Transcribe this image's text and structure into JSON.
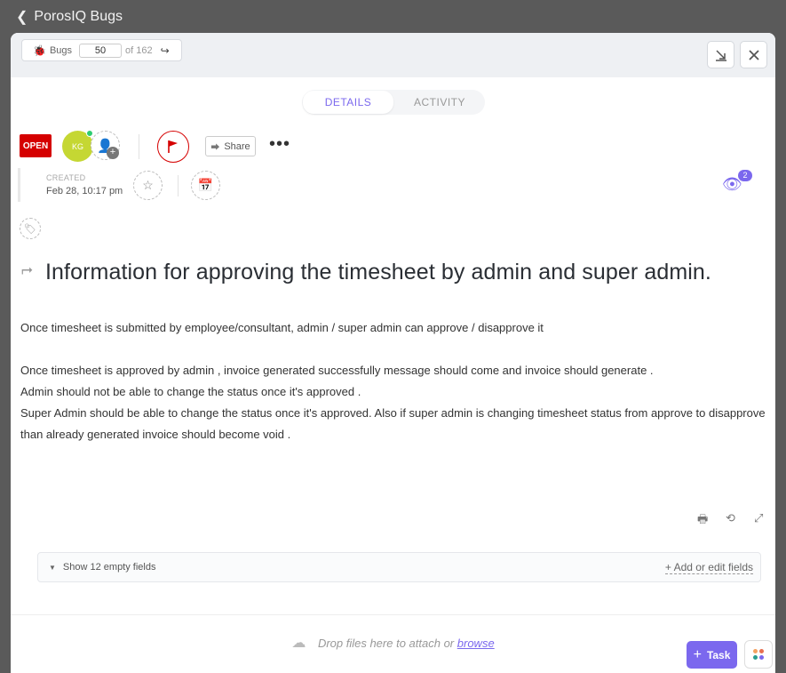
{
  "window": {
    "back_icon": "chevron-left-icon",
    "title": "PorosIQ Bugs"
  },
  "header": {
    "list_name": "Bugs",
    "current_index": "50",
    "total": "of 162",
    "minimize_icon": "minimize-down-icon",
    "close_icon": "close-icon"
  },
  "tabs": [
    {
      "label": "DETAILS"
    },
    {
      "label": "ACTIVITY"
    }
  ],
  "task": {
    "status": "OPEN",
    "status_color": "#d50000",
    "assignee_initials": "KG",
    "assignee_color": "#c5d733",
    "share_label": "Share",
    "created_label": "CREATED",
    "created_date": "Feb 28, 10:17 pm",
    "watchers_count": "2",
    "title": "Information for approving the timesheet by admin and super admin.",
    "description": [
      "Once timesheet is submitted by employee/consultant, admin / super admin can approve / disapprove it",
      "",
      "Once timesheet is approved by admin , invoice generated successfully message should come and invoice should generate .",
      "Admin should not be able to change the status once it's approved .",
      "Super Admin should be able to change the status once it's approved. Also if super admin is changing timesheet status from approve to disapprove than already generated invoice should become void ."
    ]
  },
  "fields": {
    "toggle_label": "Show 12 empty fields",
    "edit_label": "+ Add or edit fields"
  },
  "footer": {
    "drop_text": "Drop files here to attach or",
    "browse_label": "browse",
    "task_button": "Task",
    "accent_color": "#7b68ee"
  }
}
